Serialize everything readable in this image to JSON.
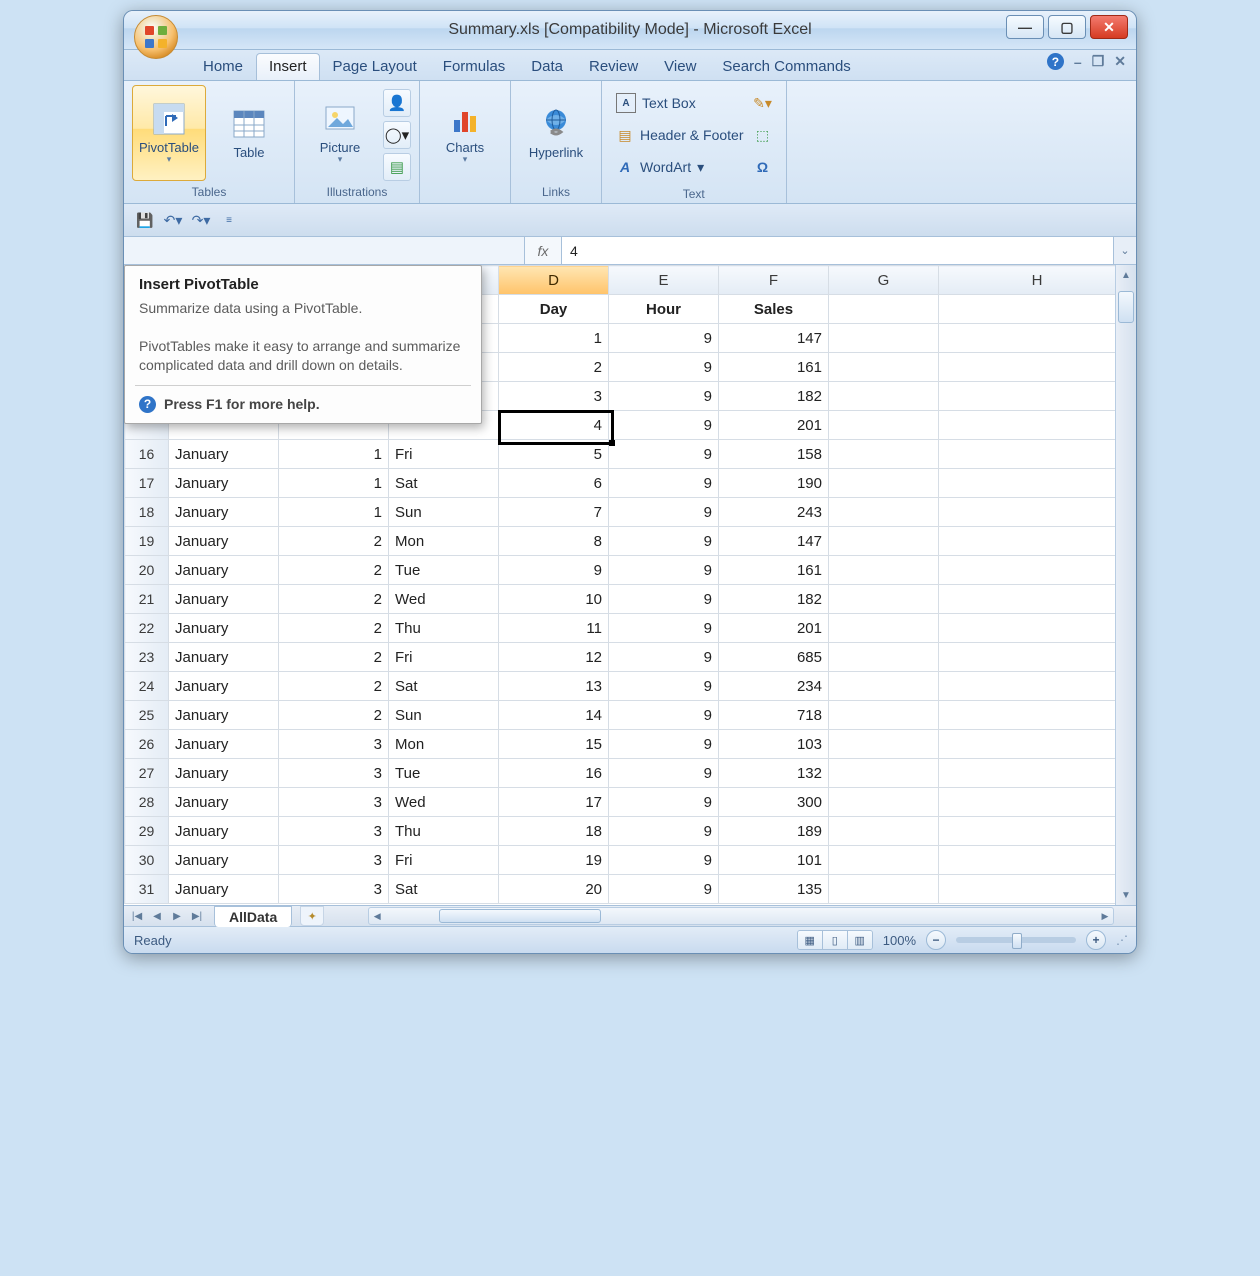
{
  "window": {
    "title": "Summary.xls  [Compatibility Mode] - Microsoft Excel"
  },
  "tabs": [
    "Home",
    "Insert",
    "Page Layout",
    "Formulas",
    "Data",
    "Review",
    "View",
    "Search Commands"
  ],
  "active_tab": "Insert",
  "ribbon": {
    "tables": {
      "label": "Tables",
      "pivot": "PivotTable",
      "table": "Table"
    },
    "illustrations": {
      "label": "Illustrations",
      "picture": "Picture"
    },
    "charts": {
      "label": "",
      "charts": "Charts"
    },
    "links": {
      "label": "Links",
      "hyperlink": "Hyperlink"
    },
    "text": {
      "label": "Text",
      "textbox": "Text Box",
      "headerfooter": "Header & Footer",
      "wordart": "WordArt"
    }
  },
  "tooltip": {
    "title": "Insert PivotTable",
    "line1": "Summarize data using a PivotTable.",
    "line2": "PivotTables make it easy to arrange and summarize complicated data and drill down on details.",
    "help": "Press F1 for more help."
  },
  "formula_bar": {
    "fx": "fx",
    "value": "4"
  },
  "columns": [
    "D",
    "E",
    "F",
    "G",
    "H"
  ],
  "active_column": "D",
  "headers": {
    "D": "Day",
    "E": "Hour",
    "F": "Sales"
  },
  "rows": [
    {
      "n": "",
      "A": "",
      "B": "",
      "C": "",
      "D": "1",
      "E": "9",
      "F": "147"
    },
    {
      "n": "",
      "A": "",
      "B": "",
      "C": "",
      "D": "2",
      "E": "9",
      "F": "161"
    },
    {
      "n": "",
      "A": "",
      "B": "",
      "C": "",
      "D": "3",
      "E": "9",
      "F": "182"
    },
    {
      "n": "",
      "A": "",
      "B": "",
      "C": "",
      "D": "4",
      "E": "9",
      "F": "201"
    },
    {
      "n": "16",
      "A": "January",
      "B": "1",
      "C": "Fri",
      "D": "5",
      "E": "9",
      "F": "158"
    },
    {
      "n": "17",
      "A": "January",
      "B": "1",
      "C": "Sat",
      "D": "6",
      "E": "9",
      "F": "190"
    },
    {
      "n": "18",
      "A": "January",
      "B": "1",
      "C": "Sun",
      "D": "7",
      "E": "9",
      "F": "243"
    },
    {
      "n": "19",
      "A": "January",
      "B": "2",
      "C": "Mon",
      "D": "8",
      "E": "9",
      "F": "147"
    },
    {
      "n": "20",
      "A": "January",
      "B": "2",
      "C": "Tue",
      "D": "9",
      "E": "9",
      "F": "161"
    },
    {
      "n": "21",
      "A": "January",
      "B": "2",
      "C": "Wed",
      "D": "10",
      "E": "9",
      "F": "182"
    },
    {
      "n": "22",
      "A": "January",
      "B": "2",
      "C": "Thu",
      "D": "11",
      "E": "9",
      "F": "201"
    },
    {
      "n": "23",
      "A": "January",
      "B": "2",
      "C": "Fri",
      "D": "12",
      "E": "9",
      "F": "685"
    },
    {
      "n": "24",
      "A": "January",
      "B": "2",
      "C": "Sat",
      "D": "13",
      "E": "9",
      "F": "234"
    },
    {
      "n": "25",
      "A": "January",
      "B": "2",
      "C": "Sun",
      "D": "14",
      "E": "9",
      "F": "718"
    },
    {
      "n": "26",
      "A": "January",
      "B": "3",
      "C": "Mon",
      "D": "15",
      "E": "9",
      "F": "103"
    },
    {
      "n": "27",
      "A": "January",
      "B": "3",
      "C": "Tue",
      "D": "16",
      "E": "9",
      "F": "132"
    },
    {
      "n": "28",
      "A": "January",
      "B": "3",
      "C": "Wed",
      "D": "17",
      "E": "9",
      "F": "300"
    },
    {
      "n": "29",
      "A": "January",
      "B": "3",
      "C": "Thu",
      "D": "18",
      "E": "9",
      "F": "189"
    },
    {
      "n": "30",
      "A": "January",
      "B": "3",
      "C": "Fri",
      "D": "19",
      "E": "9",
      "F": "101"
    },
    {
      "n": "31",
      "A": "January",
      "B": "3",
      "C": "Sat",
      "D": "20",
      "E": "9",
      "F": "135"
    }
  ],
  "sheet_tab": "AllData",
  "status": {
    "label": "Ready",
    "zoom": "100%"
  }
}
